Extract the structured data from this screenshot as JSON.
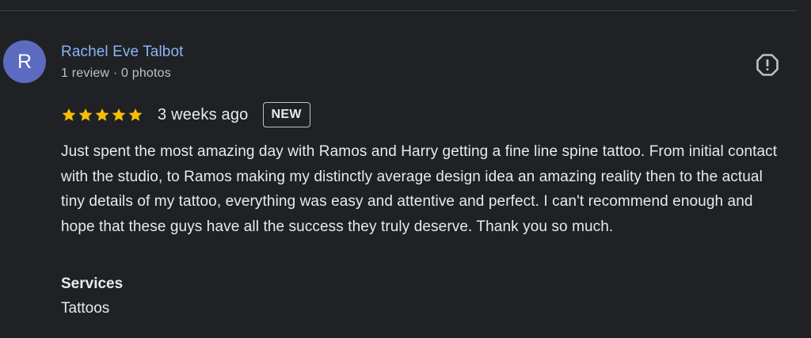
{
  "reviewer": {
    "initial": "R",
    "name": "Rachel Eve Talbot",
    "meta": "1 review · 0 photos",
    "avatar_color": "#5c6bc0"
  },
  "report": {
    "icon": "report-icon"
  },
  "rating": {
    "stars": 5,
    "max_stars": 5,
    "star_color": "#fbbc04",
    "time_ago": "3 weeks ago",
    "badge": "NEW"
  },
  "review": {
    "text": "Just spent the most amazing day with Ramos and Harry getting a fine line spine tattoo. From initial contact with the studio, to Ramos making my distinctly average design idea an amazing reality then to the actual tiny details of my tattoo, everything was easy and attentive and perfect. I can't recommend enough and hope that these guys have all the success they truly deserve. Thank you so much."
  },
  "services": {
    "heading": "Services",
    "value": "Tattoos"
  },
  "colors": {
    "background": "#202124",
    "name_link": "#8ab4f8",
    "text": "#e8eaed",
    "secondary_text": "#bdc1c6"
  }
}
